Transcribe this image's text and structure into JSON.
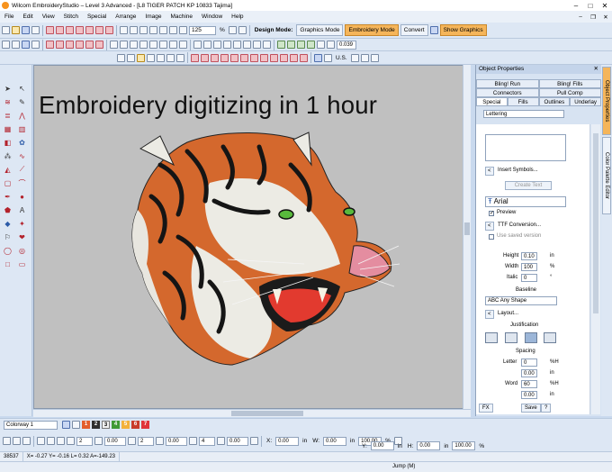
{
  "app": {
    "title": "Wilcom EmbroideryStudio – Level 3 Advanced - [L8 TIGER PATCH KP 10833      Tajima]"
  },
  "menu": [
    "File",
    "Edit",
    "View",
    "Stitch",
    "Special",
    "Arrange",
    "Image",
    "Machine",
    "Window",
    "Help"
  ],
  "toolbar": {
    "zoom_value": "125",
    "zoom_unit": "%",
    "design_mode_label": "Design Mode:",
    "graphics_mode": "Graphics Mode",
    "embroidery_mode": "Embroidery Mode",
    "convert": "Convert",
    "show_graphics": "Show Graphics",
    "width_value": "0.039",
    "unit": "U.S."
  },
  "canvas": {
    "headline": "Embroidery digitizing in 1 hour"
  },
  "panel": {
    "title": "Object Properties",
    "tabs_row1": [
      "Bling! Run",
      "Bling! Fills"
    ],
    "tabs_row2": [
      "Connectors",
      "Pull Comp"
    ],
    "tabs_row3": [
      "Special",
      "Fills",
      "Outlines",
      "Underlay"
    ],
    "object_type": "Lettering",
    "insert_symbols": "Insert Symbols...",
    "create_text": "Create Text",
    "font": "Arial",
    "preview": "Preview",
    "ttf_conversion": "TTF Conversion...",
    "use_saved_version": "Use saved version",
    "height_label": "Height",
    "height_value": "0.10",
    "height_unit": "in",
    "width_label": "Width",
    "width_value": "100",
    "width_unit": "%",
    "italic_label": "Italic",
    "italic_value": "0",
    "italic_unit": "°",
    "baseline_label": "Baseline",
    "baseline_value": "Any Shape",
    "layout": "Layout...",
    "justification_label": "Justification",
    "spacing_label": "Spacing",
    "letter_label": "Letter",
    "letter_value": "0",
    "letter_unit": "%H",
    "spacing2_value": "0.00",
    "spacing2_unit": "in",
    "word_label": "Word",
    "word_value": "60",
    "word_unit": "%H",
    "spacing4_value": "0.00",
    "spacing4_unit": "in",
    "fx_label": "FX",
    "save_label": "Save",
    "help_label": "?"
  },
  "side_tabs": [
    "Object Properties",
    "Color Palette Editor"
  ],
  "colorway": {
    "name": "Colorway 1",
    "swatches": [
      {
        "n": "1",
        "color": "#e35d2b"
      },
      {
        "n": "2",
        "color": "#2f2f2f"
      },
      {
        "n": "3",
        "color": "#f2f2f2"
      },
      {
        "n": "4",
        "color": "#3f9a35"
      },
      {
        "n": "5",
        "color": "#f3b13a"
      },
      {
        "n": "6",
        "color": "#c83c2b"
      },
      {
        "n": "7",
        "color": "#e0343a"
      }
    ]
  },
  "bottom_fields": {
    "f1": "2",
    "f2": "0.00",
    "f3": "2",
    "f4": "0.00",
    "f5": "4",
    "f6": "0.00",
    "x_label": "X:",
    "x_value": "0.00",
    "x_unit": "in",
    "y_label": "Y:",
    "y_value": "0.00",
    "y_unit": "in",
    "w_label": "W:",
    "w_value": "0.00",
    "w_unit": "in",
    "h_label": "H:",
    "h_value": "0.00",
    "h_unit": "in",
    "sx_value": "100.00",
    "sx_unit": "%",
    "sy_value": "100.00",
    "sy_unit": "%"
  },
  "status": {
    "stitches": "38537",
    "coords": "X=  -0.27 Y=  -0.16 L=   0.32 A=-149.23",
    "jump": "Jump (M)"
  }
}
